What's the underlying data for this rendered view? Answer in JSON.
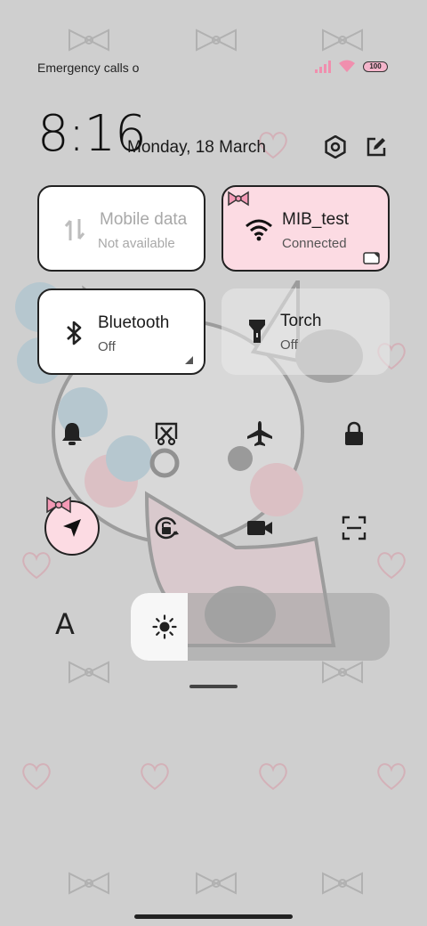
{
  "status_bar": {
    "carrier_text": "Emergency calls o",
    "battery_level": "100",
    "icons": [
      "signal-icon",
      "wifi-icon",
      "battery-icon"
    ]
  },
  "header": {
    "time": "8:16",
    "date": "Monday, 18 March",
    "buttons": [
      "settings-icon",
      "edit-icon"
    ]
  },
  "tiles": {
    "mobile_data": {
      "title": "Mobile data",
      "subtitle": "Not available",
      "icon": "mobile-data-icon",
      "state": "disabled"
    },
    "wifi": {
      "title": "MIB_test",
      "subtitle": "Connected",
      "icon": "wifi-icon",
      "state": "on"
    },
    "bluetooth": {
      "title": "Bluetooth",
      "subtitle": "Off",
      "icon": "bluetooth-icon",
      "state": "off"
    },
    "torch": {
      "title": "Torch",
      "subtitle": "Off",
      "icon": "torch-icon",
      "state": "off"
    }
  },
  "toggles_row1": [
    "bell-icon",
    "screenshot-icon",
    "airplane-icon",
    "lock-icon"
  ],
  "toggles_row2": [
    "location-icon",
    "rotation-lock-icon",
    "video-camera-icon",
    "scanner-icon"
  ],
  "brightness": {
    "level_fraction": 0.22,
    "icon": "sun-icon"
  },
  "font_button_label": "A",
  "colors": {
    "accent_pink": "#fcdbe3",
    "tile_white": "#ffffff",
    "background": "#cfcfcf"
  }
}
